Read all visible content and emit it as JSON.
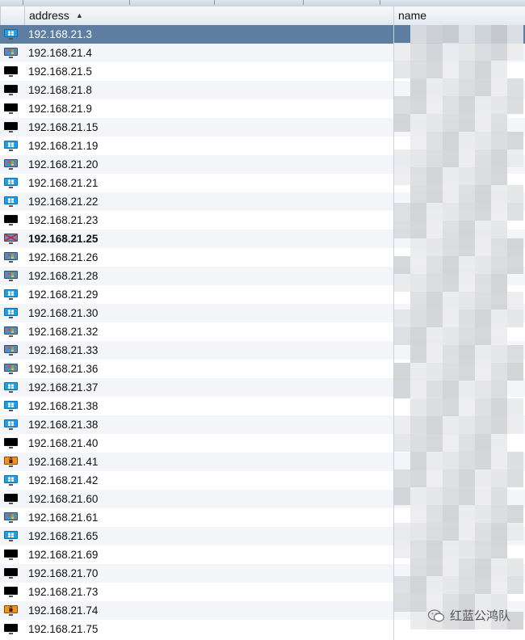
{
  "columns": {
    "address": "address",
    "name": "name"
  },
  "rows": [
    {
      "icon": "windows-monitor-icon",
      "address": "192.168.21.3",
      "selected": true
    },
    {
      "icon": "windows-logo-monitor-icon",
      "address": "192.168.21.4"
    },
    {
      "icon": "black-monitor-icon",
      "address": "192.168.21.5"
    },
    {
      "icon": "black-monitor-icon",
      "address": "192.168.21.8"
    },
    {
      "icon": "black-monitor-icon",
      "address": "192.168.21.9"
    },
    {
      "icon": "black-monitor-icon",
      "address": "192.168.21.15"
    },
    {
      "icon": "windows-monitor-icon",
      "address": "192.168.21.19"
    },
    {
      "icon": "windows-logo-monitor-icon",
      "address": "192.168.21.20"
    },
    {
      "icon": "windows-monitor-icon",
      "address": "192.168.21.21"
    },
    {
      "icon": "windows-monitor-icon",
      "address": "192.168.21.22"
    },
    {
      "icon": "black-monitor-icon",
      "address": "192.168.21.23"
    },
    {
      "icon": "compromised-monitor-icon",
      "address": "192.168.21.25",
      "bold": true
    },
    {
      "icon": "windows-logo-monitor-icon",
      "address": "192.168.21.26"
    },
    {
      "icon": "windows-logo-monitor-icon",
      "address": "192.168.21.28"
    },
    {
      "icon": "windows-monitor-icon",
      "address": "192.168.21.29"
    },
    {
      "icon": "windows-monitor-icon",
      "address": "192.168.21.30"
    },
    {
      "icon": "windows-logo-monitor-icon",
      "address": "192.168.21.32"
    },
    {
      "icon": "windows-logo-monitor-icon",
      "address": "192.168.21.33"
    },
    {
      "icon": "windows-logo-monitor-icon",
      "address": "192.168.21.36"
    },
    {
      "icon": "windows-monitor-icon",
      "address": "192.168.21.37"
    },
    {
      "icon": "windows-monitor-icon",
      "address": "192.168.21.38"
    },
    {
      "icon": "windows-monitor-icon",
      "address": "192.168.21.38"
    },
    {
      "icon": "black-monitor-icon",
      "address": "192.168.21.40"
    },
    {
      "icon": "locked-monitor-icon",
      "address": "192.168.21.41"
    },
    {
      "icon": "windows-monitor-icon",
      "address": "192.168.21.42"
    },
    {
      "icon": "black-monitor-icon",
      "address": "192.168.21.60"
    },
    {
      "icon": "windows-logo-monitor-icon",
      "address": "192.168.21.61"
    },
    {
      "icon": "windows-monitor-icon",
      "address": "192.168.21.65"
    },
    {
      "icon": "black-monitor-icon",
      "address": "192.168.21.69"
    },
    {
      "icon": "black-monitor-icon",
      "address": "192.168.21.70"
    },
    {
      "icon": "black-monitor-icon",
      "address": "192.168.21.73"
    },
    {
      "icon": "locked-monitor-icon",
      "address": "192.168.21.74"
    },
    {
      "icon": "black-monitor-icon",
      "address": "192.168.21.75"
    }
  ],
  "watermark": {
    "text": "红蓝公鸿队"
  },
  "colors": {
    "selected_row": "#5d7ea0",
    "alt_row": "#f3f5f8",
    "win_blue": "#1e9ee6"
  }
}
